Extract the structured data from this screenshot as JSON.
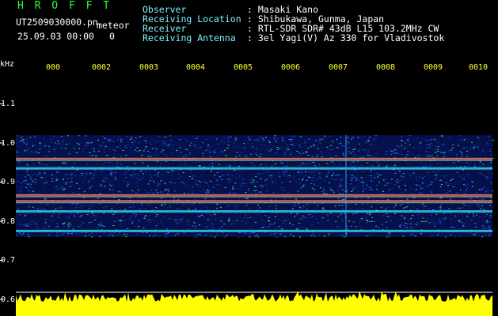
{
  "header": {
    "brand": "H R O F F T",
    "file_name": "UT2509030000.pn",
    "mode": "meteor",
    "datetime": "25.09.03 00:00",
    "count": "0"
  },
  "info": {
    "observer_label": "Observer",
    "observer_value": ": Masaki Kano",
    "location_label": "Receiving Location",
    "location_value": ": Shibukawa, Gunma, Japan",
    "receiver_label": "Receiver",
    "receiver_value": ": RTL-SDR SDR# 43dB L15 103.2MHz CW",
    "antenna_label": "Receiving Antenna",
    "antenna_value": ": 3el Yagi(V) Az 330 for Vladivostok"
  },
  "axis": {
    "unit": "kHz",
    "y_ticks": [
      "1.1",
      "1.0",
      "0.9",
      "0.8",
      "0.7",
      "0.6"
    ],
    "x_ticks": [
      "000",
      "0002",
      "0003",
      "0004",
      "0005",
      "0006",
      "0007",
      "0008",
      "0009",
      "0010"
    ]
  },
  "colors": {
    "background": "#000000",
    "label_text": "#7ff0ff",
    "tick_text": "#ffff33",
    "brand": "#36ff36",
    "amplitude": "#ffff00",
    "strong_line": "#ff3050"
  },
  "chart_data": {
    "type": "heatmap",
    "y_range_khz": [
      0.6,
      1.12
    ],
    "signal_band_khz": [
      0.76,
      1.02
    ],
    "strong_lines_khz": [
      0.958,
      0.865,
      0.85
    ],
    "medium_lines_khz": [
      0.935,
      0.825,
      0.775
    ],
    "amplitude_strip": true
  }
}
